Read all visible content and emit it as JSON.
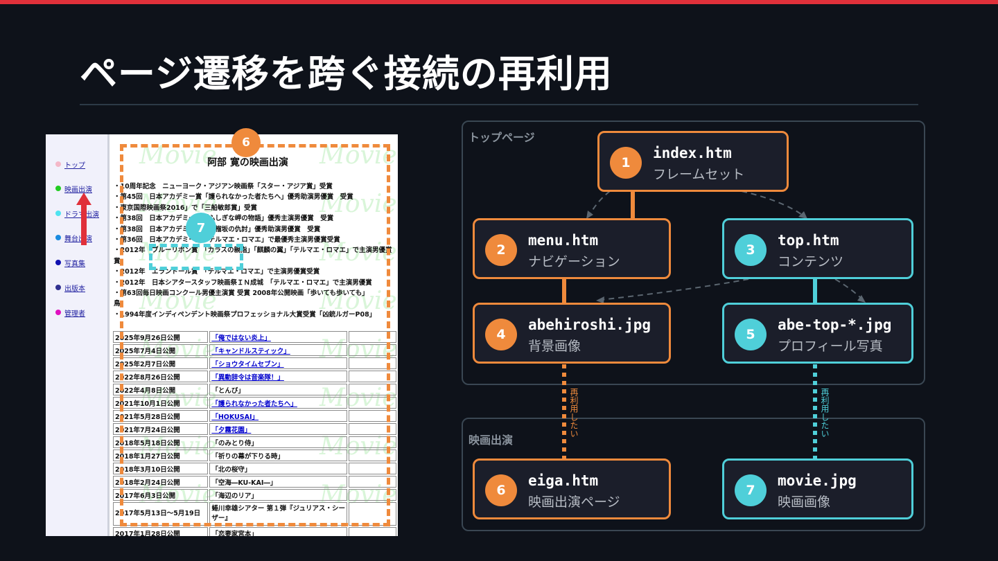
{
  "title": "ページ遷移を跨ぐ接続の再利用",
  "screenshot": {
    "menu": [
      {
        "label": "トップ",
        "color": "#f4b8c8"
      },
      {
        "label": "映画出演",
        "color": "#22cc22"
      },
      {
        "label": "ドラマ出演",
        "color": "#4fe3f0"
      },
      {
        "label": "舞台出演",
        "color": "#1a8be0"
      },
      {
        "label": "写真集",
        "color": "#1010b0"
      },
      {
        "label": "出版本",
        "color": "#303090"
      },
      {
        "label": "管理者",
        "color": "#e010c0"
      }
    ],
    "watermark": "Movie",
    "heading": "阿部 寛の映画出演",
    "awards": [
      "・10周年記念　ニューヨーク・アジアン映画祭「スター・アジア賞」受賞",
      "・第45回　日本アカデミー賞「護られなかった者たちへ」優秀助演男優賞　受賞",
      "・東京国際映画祭2016」で「三船敏郎賞」受賞",
      "・第38回　日本アカデミー賞「ふしぎな岬の物語」優秀主演男優賞　受賞",
      "・第38回　日本アカデミー賞「柘榴坂の仇討」優秀助演男優賞　受賞",
      "・第36回　日本アカデミー賞「テルマエ・ロマエ」で最優秀主演男優賞受賞",
      "・2012年　ブルーリボン賞　「カラスの親指」「麒麟の翼」「テルマエ・ロマエ」で主演男優賞",
      "賞",
      "・2012年　エランドール賞　「テルマエ・ロマエ」で主演男優賞受賞",
      "・2012年　日本シアタースタッフ映画祭ＩＮ成城　「テルマエ・ロマエ」で主演男優賞",
      "・第63回毎日映画コンクール男優主演賞 受賞 2008年公開映画「歩いても歩いても」",
      "鳥",
      "・1994年度インディペンデント映画祭プロフェッショナル大賞受賞「凶銃ルガーP08」"
    ],
    "films": [
      {
        "date": "2025年9月26日公開",
        "title": "「俺ではない炎上」",
        "link": true
      },
      {
        "date": "2025年7月4日公開",
        "title": "「キャンドルスティック」",
        "link": true
      },
      {
        "date": "2025年2月7日公開",
        "title": "「ショウタイムセブン」",
        "link": true
      },
      {
        "date": "2022年8月26日公開",
        "title": "「異動辞令は音楽隊！」",
        "link": true
      },
      {
        "date": "2022年4月8日公開",
        "title": "「とんび」",
        "link": false
      },
      {
        "date": "2021年10月1日公開",
        "title": "「護られなかった者たちへ」",
        "link": true
      },
      {
        "date": "2021年5月28日公開",
        "title": "「HOKUSAI」",
        "link": true
      },
      {
        "date": "2021年7月24日公開",
        "title": "「夕霧花園」",
        "link": true
      },
      {
        "date": "2018年5月18日公開",
        "title": "「のみとり侍」",
        "link": false
      },
      {
        "date": "2018年1月27日公開",
        "title": "「祈りの幕が下りる時」",
        "link": false
      },
      {
        "date": "2018年3月10日公開",
        "title": "「北の桜守」",
        "link": false
      },
      {
        "date": "2018年2月24日公開",
        "title": "「空海―KU-KAI―」",
        "link": false
      },
      {
        "date": "2017年6月3日公開",
        "title": "「海辺のリア」",
        "link": false
      },
      {
        "date": "2017年5月13日～5月19日",
        "title": "蜷川幸雄シアター 第１弾『ジュリアス・シーザー』",
        "link": false
      },
      {
        "date": "2017年1月28日公開",
        "title": "「恋妻家宮本」",
        "link": false
      }
    ],
    "badge6": "6",
    "badge7": "7"
  },
  "diagram": {
    "groups": {
      "top": "トップページ",
      "movie": "映画出演"
    },
    "nodes": {
      "n1": {
        "num": "1",
        "name": "index.htm",
        "sub": "フレームセット"
      },
      "n2": {
        "num": "2",
        "name": "menu.htm",
        "sub": "ナビゲーション"
      },
      "n3": {
        "num": "3",
        "name": "top.htm",
        "sub": "コンテンツ"
      },
      "n4": {
        "num": "4",
        "name": "abehiroshi.jpg",
        "sub": "背景画像"
      },
      "n5": {
        "num": "5",
        "name": "abe-top-*.jpg",
        "sub": "プロフィール写真"
      },
      "n6": {
        "num": "6",
        "name": "eiga.htm",
        "sub": "映画出演ページ"
      },
      "n7": {
        "num": "7",
        "name": "movie.jpg",
        "sub": "映画画像"
      }
    },
    "reuse_label": "再利用したい",
    "colors": {
      "orange": "#ef8a3c",
      "cyan": "#4fcfd9",
      "red": "#e0303a",
      "dashed_gray": "#5b6670"
    }
  }
}
